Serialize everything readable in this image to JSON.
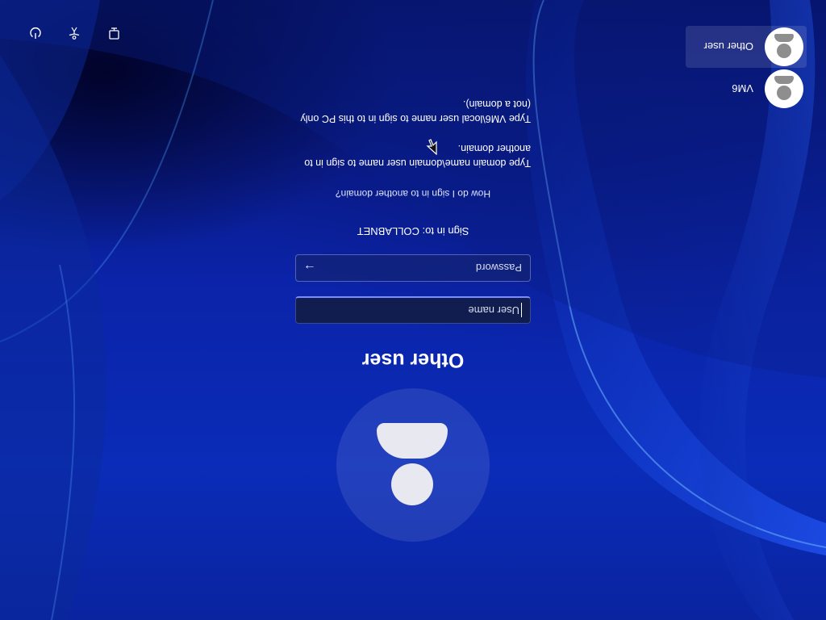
{
  "users": [
    {
      "name": "VM6",
      "selected": false
    },
    {
      "name": "Other user",
      "selected": true
    }
  ],
  "login": {
    "title": "Other user",
    "username_placeholder": "User name",
    "password_placeholder": "Password",
    "sign_in_to": "Sign in to: COLLABNET",
    "howto_link": "How do I sign in to another domain?",
    "help_domain": "Type domain name\\domain user name to sign in to another domain.",
    "help_local": "Type VM6\\local user name to sign in to this PC only (not a domain)."
  },
  "system_buttons": [
    {
      "icon": "network-icon"
    },
    {
      "icon": "accessibility-icon"
    },
    {
      "icon": "power-icon"
    }
  ],
  "colors": {
    "background": "#0b23a8",
    "field_focus": "#7a8cff"
  }
}
